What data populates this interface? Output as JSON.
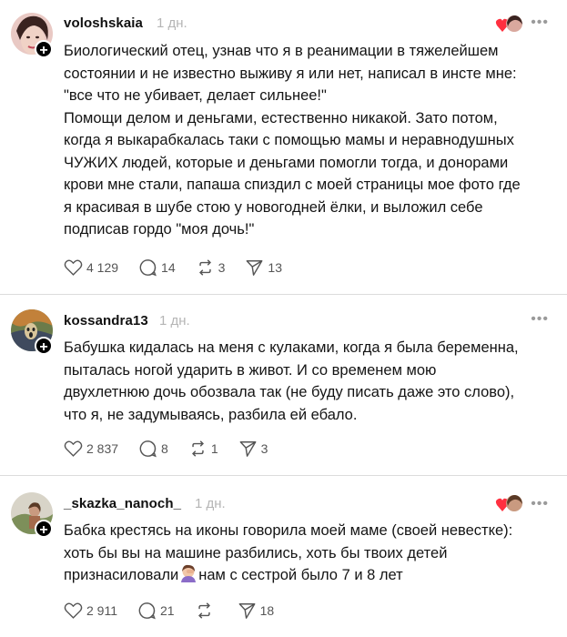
{
  "posts": [
    {
      "username": "voloshskaia",
      "time": "1 дн.",
      "text": "Биологический отец, узнав что я в реанимации в тяжелейшем\nсостоянии и не известно выживу я или нет, написал в инсте мне:\n\"все что не убивает, делает сильнее!\"\nПомощи делом и деньгами, естественно никакой. Зато потом,\nкогда я выкарабкалась таки с помощью мамы и неравнодушных\nЧУЖИХ людей, которые и деньгами помогли тогда, и донорами\nкрови мне стали, папаша спиздил с моей страницы мое фото где\nя красивая в шубе стою у новогодней ёлки, и выложил себе\nподписав гордо \"моя дочь!\"",
      "likes": "4 129",
      "comments": "14",
      "reposts": "3",
      "shares": "13"
    },
    {
      "username": "kossandra13",
      "time": "1 дн.",
      "text": "Бабушка кидалась на меня с кулаками, когда я была беременна,\nпыталась ногой ударить в живот. И со временем мою\nдвухлетнюю дочь обозвала так (не буду писать даже это слово),\nчто я, не задумываясь, разбила ей ебало.",
      "likes": "2 837",
      "comments": "8",
      "reposts": "1",
      "shares": "3"
    },
    {
      "username": "_skazka_nanoch_",
      "time": "1 дн.",
      "text_lines": [
        "Бабка крестясь на иконы говорила моей маме (своей невестке):",
        "хоть бы вы на машине разбились, хоть бы твоих детей"
      ],
      "text_last_before": "признасиловали",
      "text_last_after": "нам с сестрой было 7 и 8 лет",
      "likes": "2 911",
      "comments": "21",
      "reposts": "",
      "shares": "18"
    }
  ],
  "icons": {
    "plus": "+",
    "more": "•••"
  },
  "colors": {
    "accent_heart": "#ff3040",
    "muted": "#9a9a9a",
    "divider": "#dcdcdc"
  }
}
